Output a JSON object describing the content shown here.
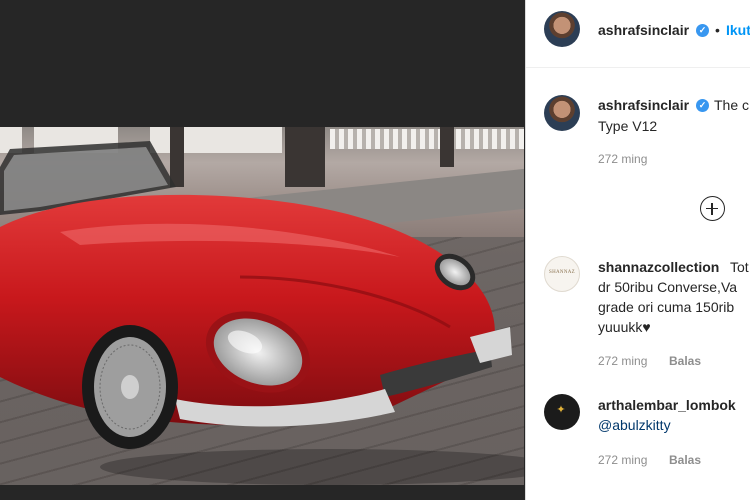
{
  "post": {
    "owner": {
      "username": "ashrafsinclair",
      "verified": true,
      "follow_label": "Ikuti",
      "separator": "•"
    },
    "caption": {
      "username": "ashrafsinclair",
      "text_line1": "The c",
      "text_line2": "Type V12",
      "time": "272 ming"
    },
    "load_more_icon": "plus-circle-icon"
  },
  "comments": [
    {
      "username": "shannazcollection",
      "avatar_text": "SHANNAZ",
      "lines": [
        "Tot",
        "dr 50ribu Converse,Va",
        "grade ori cuma 150rib",
        "yuuukk♥"
      ],
      "time": "272 ming",
      "reply_label": "Balas"
    },
    {
      "username": "arthalembar_lombok",
      "mention": "@abulzkitty",
      "time": "272 ming",
      "reply_label": "Balas"
    }
  ],
  "colors": {
    "accent": "#0095f6",
    "verified": "#3897f0",
    "text": "#262626",
    "muted": "#8e8e8e",
    "photo_backdrop": "#262626",
    "car": "#c8181c"
  }
}
